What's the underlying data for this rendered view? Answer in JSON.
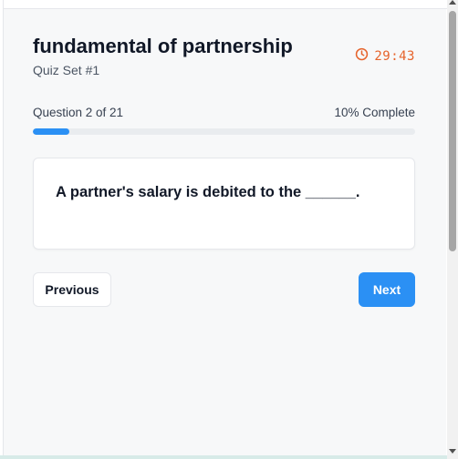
{
  "quiz": {
    "title": "fundamental of partnership",
    "subtitle": "Quiz Set #1",
    "timer": "29:43"
  },
  "progress": {
    "question_label": "Question 2 of 21",
    "percent_label": "10% Complete",
    "fraction": 0.095
  },
  "question": {
    "text": "A partner's salary is debited to the ______."
  },
  "navigation": {
    "previous_label": "Previous",
    "next_label": "Next"
  },
  "colors": {
    "accent": "#2b90f4",
    "timer": "#e6632b"
  },
  "icons": {
    "timer": "clock-icon"
  }
}
